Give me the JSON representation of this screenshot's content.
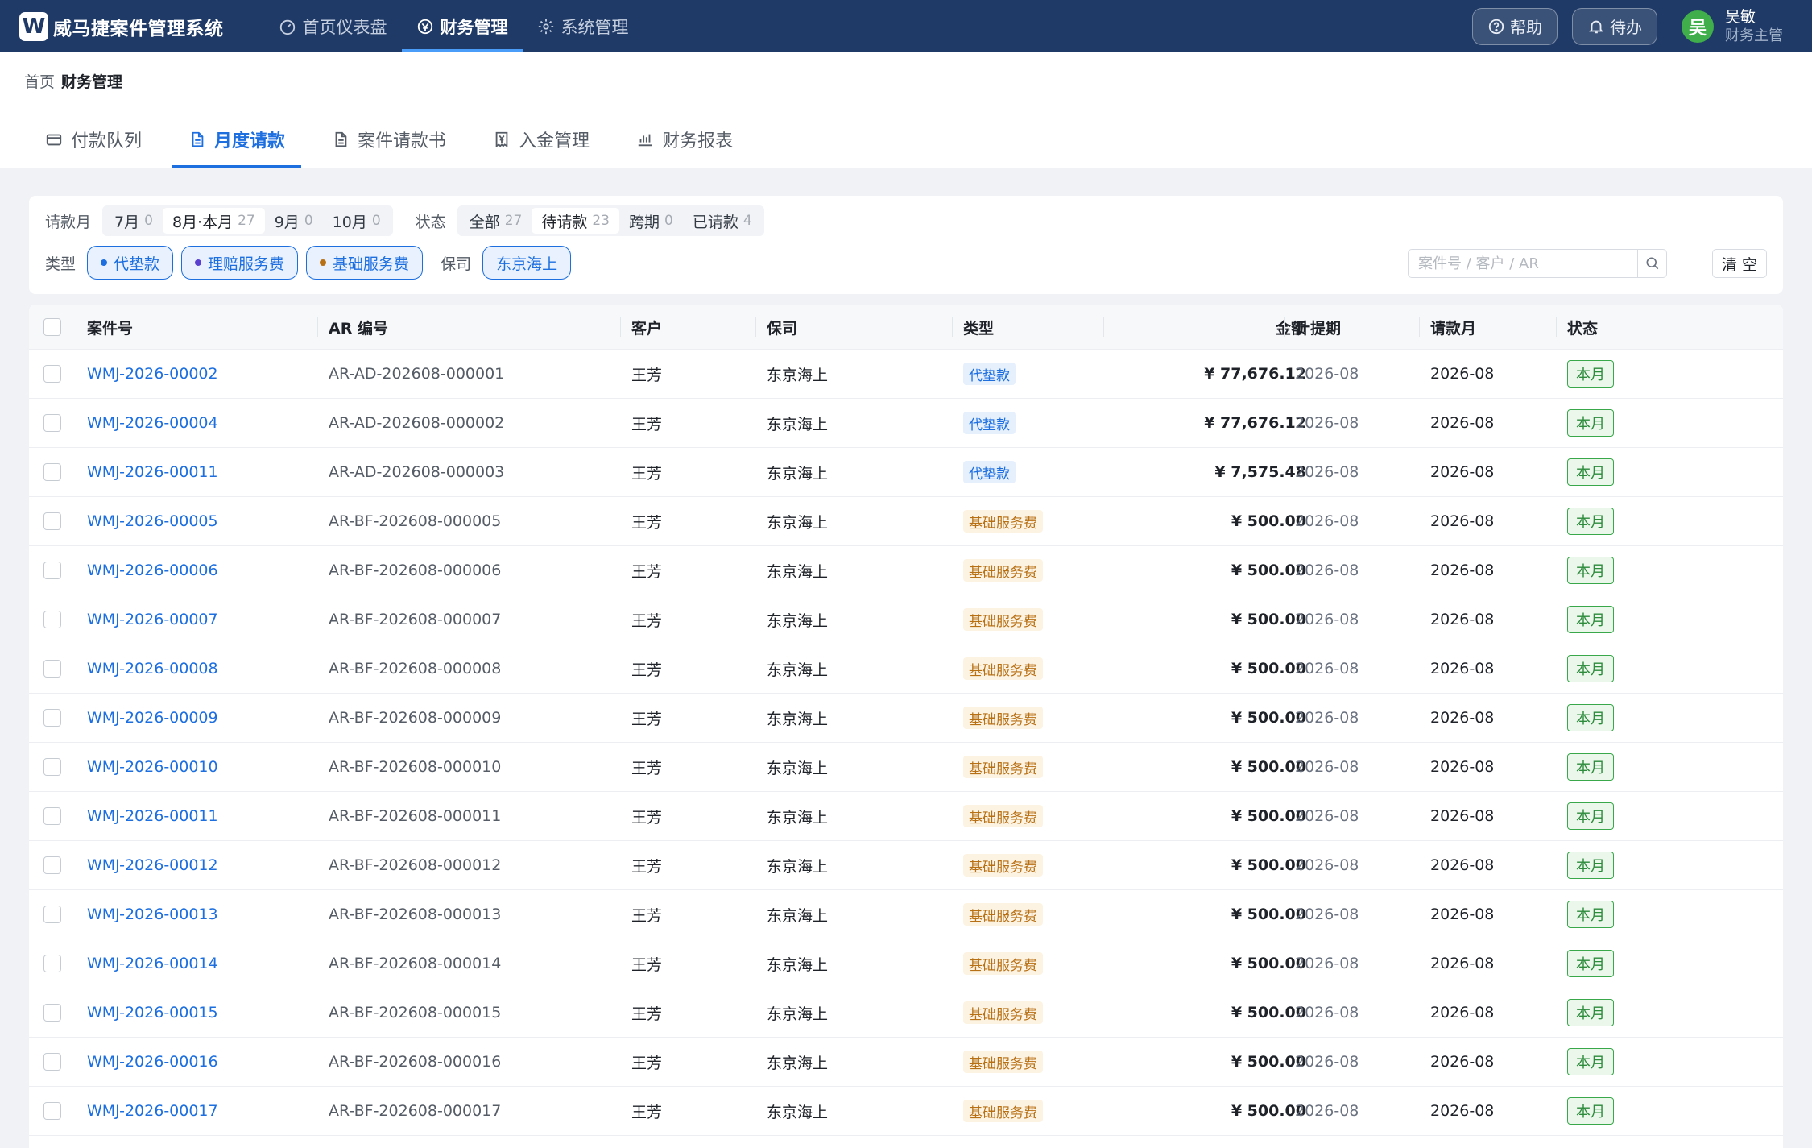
{
  "app": {
    "logo_letter": "W",
    "title": "威马捷案件管理系统"
  },
  "nav": [
    {
      "label": "首页仪表盘",
      "icon": "dashboard-icon"
    },
    {
      "label": "财务管理",
      "icon": "finance-icon",
      "active": true
    },
    {
      "label": "系统管理",
      "icon": "gear-icon"
    }
  ],
  "header_actions": {
    "help": "帮助",
    "todo": "待办"
  },
  "user": {
    "avatar": "吴",
    "name": "吴敏",
    "role": "财务主管"
  },
  "breadcrumb": {
    "home": "首页",
    "current": "财务管理"
  },
  "tabs": [
    {
      "label": "付款队列",
      "icon": "wallet-icon"
    },
    {
      "label": "月度请款",
      "icon": "document-icon",
      "active": true
    },
    {
      "label": "案件请款书",
      "icon": "document-icon"
    },
    {
      "label": "入金管理",
      "icon": "yen-receipt-icon"
    },
    {
      "label": "财务报表",
      "icon": "bar-chart-icon"
    }
  ],
  "filters": {
    "month_label": "请款月",
    "months": [
      {
        "label": "7月",
        "count": "0"
      },
      {
        "label": "8月·本月",
        "count": "27",
        "active": true
      },
      {
        "label": "9月",
        "count": "0"
      },
      {
        "label": "10月",
        "count": "0"
      }
    ],
    "status_label": "状态",
    "statuses": [
      {
        "label": "全部",
        "count": "27"
      },
      {
        "label": "待请款",
        "count": "23",
        "active": true
      },
      {
        "label": "跨期",
        "count": "0"
      },
      {
        "label": "已请款",
        "count": "4"
      }
    ],
    "type_label": "类型",
    "types": [
      {
        "label": "代垫款",
        "dot": "#1d6fe0"
      },
      {
        "label": "理赔服务费",
        "dot": "#5a3fd0"
      },
      {
        "label": "基础服务费",
        "dot": "#b87014"
      }
    ],
    "insurer_label": "保司",
    "insurer": "东京海上",
    "search_placeholder": "案件号 / 客户 / AR",
    "search_value": "",
    "clear": "清空"
  },
  "table": {
    "columns": [
      "案件号",
      "AR 编号",
      "客户",
      "保司",
      "类型",
      "金额",
      "计提期",
      "请款月",
      "状态"
    ],
    "rows": [
      {
        "case": "WMJ-2026-00002",
        "ar": "AR-AD-202608-000001",
        "customer": "王芳",
        "insurer": "东京海上",
        "type": "代垫款",
        "amount": "¥ 77,676.12",
        "period": "2026-08",
        "req_month": "2026-08",
        "status": "本月"
      },
      {
        "case": "WMJ-2026-00004",
        "ar": "AR-AD-202608-000002",
        "customer": "王芳",
        "insurer": "东京海上",
        "type": "代垫款",
        "amount": "¥ 77,676.12",
        "period": "2026-08",
        "req_month": "2026-08",
        "status": "本月"
      },
      {
        "case": "WMJ-2026-00011",
        "ar": "AR-AD-202608-000003",
        "customer": "王芳",
        "insurer": "东京海上",
        "type": "代垫款",
        "amount": "¥ 7,575.48",
        "period": "2026-08",
        "req_month": "2026-08",
        "status": "本月"
      },
      {
        "case": "WMJ-2026-00005",
        "ar": "AR-BF-202608-000005",
        "customer": "王芳",
        "insurer": "东京海上",
        "type": "基础服务费",
        "amount": "¥ 500.00",
        "period": "2026-08",
        "req_month": "2026-08",
        "status": "本月"
      },
      {
        "case": "WMJ-2026-00006",
        "ar": "AR-BF-202608-000006",
        "customer": "王芳",
        "insurer": "东京海上",
        "type": "基础服务费",
        "amount": "¥ 500.00",
        "period": "2026-08",
        "req_month": "2026-08",
        "status": "本月"
      },
      {
        "case": "WMJ-2026-00007",
        "ar": "AR-BF-202608-000007",
        "customer": "王芳",
        "insurer": "东京海上",
        "type": "基础服务费",
        "amount": "¥ 500.00",
        "period": "2026-08",
        "req_month": "2026-08",
        "status": "本月"
      },
      {
        "case": "WMJ-2026-00008",
        "ar": "AR-BF-202608-000008",
        "customer": "王芳",
        "insurer": "东京海上",
        "type": "基础服务费",
        "amount": "¥ 500.00",
        "period": "2026-08",
        "req_month": "2026-08",
        "status": "本月"
      },
      {
        "case": "WMJ-2026-00009",
        "ar": "AR-BF-202608-000009",
        "customer": "王芳",
        "insurer": "东京海上",
        "type": "基础服务费",
        "amount": "¥ 500.00",
        "period": "2026-08",
        "req_month": "2026-08",
        "status": "本月"
      },
      {
        "case": "WMJ-2026-00010",
        "ar": "AR-BF-202608-000010",
        "customer": "王芳",
        "insurer": "东京海上",
        "type": "基础服务费",
        "amount": "¥ 500.00",
        "period": "2026-08",
        "req_month": "2026-08",
        "status": "本月"
      },
      {
        "case": "WMJ-2026-00011",
        "ar": "AR-BF-202608-000011",
        "customer": "王芳",
        "insurer": "东京海上",
        "type": "基础服务费",
        "amount": "¥ 500.00",
        "period": "2026-08",
        "req_month": "2026-08",
        "status": "本月"
      },
      {
        "case": "WMJ-2026-00012",
        "ar": "AR-BF-202608-000012",
        "customer": "王芳",
        "insurer": "东京海上",
        "type": "基础服务费",
        "amount": "¥ 500.00",
        "period": "2026-08",
        "req_month": "2026-08",
        "status": "本月"
      },
      {
        "case": "WMJ-2026-00013",
        "ar": "AR-BF-202608-000013",
        "customer": "王芳",
        "insurer": "东京海上",
        "type": "基础服务费",
        "amount": "¥ 500.00",
        "period": "2026-08",
        "req_month": "2026-08",
        "status": "本月"
      },
      {
        "case": "WMJ-2026-00014",
        "ar": "AR-BF-202608-000014",
        "customer": "王芳",
        "insurer": "东京海上",
        "type": "基础服务费",
        "amount": "¥ 500.00",
        "period": "2026-08",
        "req_month": "2026-08",
        "status": "本月"
      },
      {
        "case": "WMJ-2026-00015",
        "ar": "AR-BF-202608-000015",
        "customer": "王芳",
        "insurer": "东京海上",
        "type": "基础服务费",
        "amount": "¥ 500.00",
        "period": "2026-08",
        "req_month": "2026-08",
        "status": "本月"
      },
      {
        "case": "WMJ-2026-00016",
        "ar": "AR-BF-202608-000016",
        "customer": "王芳",
        "insurer": "东京海上",
        "type": "基础服务费",
        "amount": "¥ 500.00",
        "period": "2026-08",
        "req_month": "2026-08",
        "status": "本月"
      },
      {
        "case": "WMJ-2026-00017",
        "ar": "AR-BF-202608-000017",
        "customer": "王芳",
        "insurer": "东京海上",
        "type": "基础服务费",
        "amount": "¥ 500.00",
        "period": "2026-08",
        "req_month": "2026-08",
        "status": "本月"
      }
    ]
  }
}
